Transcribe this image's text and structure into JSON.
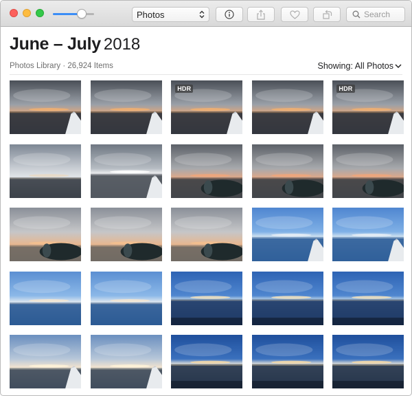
{
  "toolbar": {
    "source_select": "Photos",
    "search_placeholder": "Search"
  },
  "header": {
    "title_bold": "June – July",
    "title_year": "2018",
    "subtitle": "Photos Library · 26,924 Items",
    "showing_label": "Showing: All Photos"
  },
  "zoom_level": 0.75,
  "photos": [
    {
      "style": "A",
      "hdr": ""
    },
    {
      "style": "A",
      "hdr": ""
    },
    {
      "style": "A",
      "hdr": "HDR"
    },
    {
      "style": "A",
      "hdr": ""
    },
    {
      "style": "A",
      "hdr": "HDR"
    },
    {
      "style": "B",
      "hdr": ""
    },
    {
      "style": "C",
      "hdr": ""
    },
    {
      "style": "D",
      "hdr": ""
    },
    {
      "style": "D",
      "hdr": ""
    },
    {
      "style": "D",
      "hdr": ""
    },
    {
      "style": "E",
      "hdr": ""
    },
    {
      "style": "E",
      "hdr": ""
    },
    {
      "style": "E",
      "hdr": ""
    },
    {
      "style": "F",
      "hdr": ""
    },
    {
      "style": "F",
      "hdr": ""
    },
    {
      "style": "G",
      "hdr": ""
    },
    {
      "style": "G",
      "hdr": ""
    },
    {
      "style": "H",
      "hdr": ""
    },
    {
      "style": "H",
      "hdr": ""
    },
    {
      "style": "H",
      "hdr": ""
    },
    {
      "style": "I",
      "hdr": ""
    },
    {
      "style": "I",
      "hdr": ""
    },
    {
      "style": "J",
      "hdr": ""
    },
    {
      "style": "J",
      "hdr": ""
    },
    {
      "style": "J",
      "hdr": ""
    }
  ]
}
